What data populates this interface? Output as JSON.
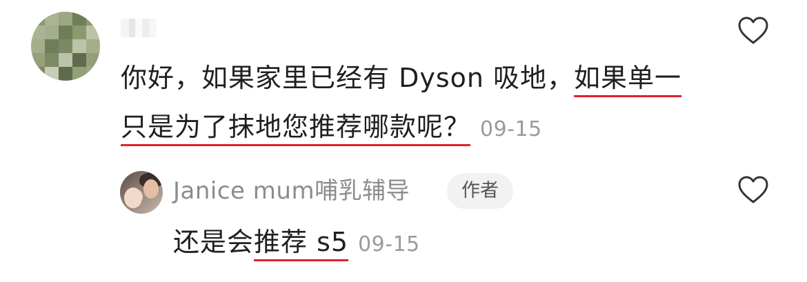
{
  "comment": {
    "date": "09-15",
    "text_before": "你好，如果家里已经有 Dyson 吸地，",
    "text_highlight": "如果单一只是为了抹地您推荐哪款呢？",
    "avatar_icon": "pixelated-avatar-icon",
    "like_icon": "heart-outline-icon"
  },
  "reply": {
    "author": "Janice mum哺乳辅导",
    "badge": "作者",
    "text_before": "还是会",
    "text_highlight": "推荐 s5",
    "date": "09-15",
    "avatar_icon": "baby-photo-avatar-icon",
    "like_icon": "heart-outline-icon"
  },
  "colors": {
    "text": "#1f1f1f",
    "meta": "#9a9a9a",
    "author": "#8c8c8c",
    "underline": "#e0202e",
    "badge_bg": "#f2f2f2"
  }
}
